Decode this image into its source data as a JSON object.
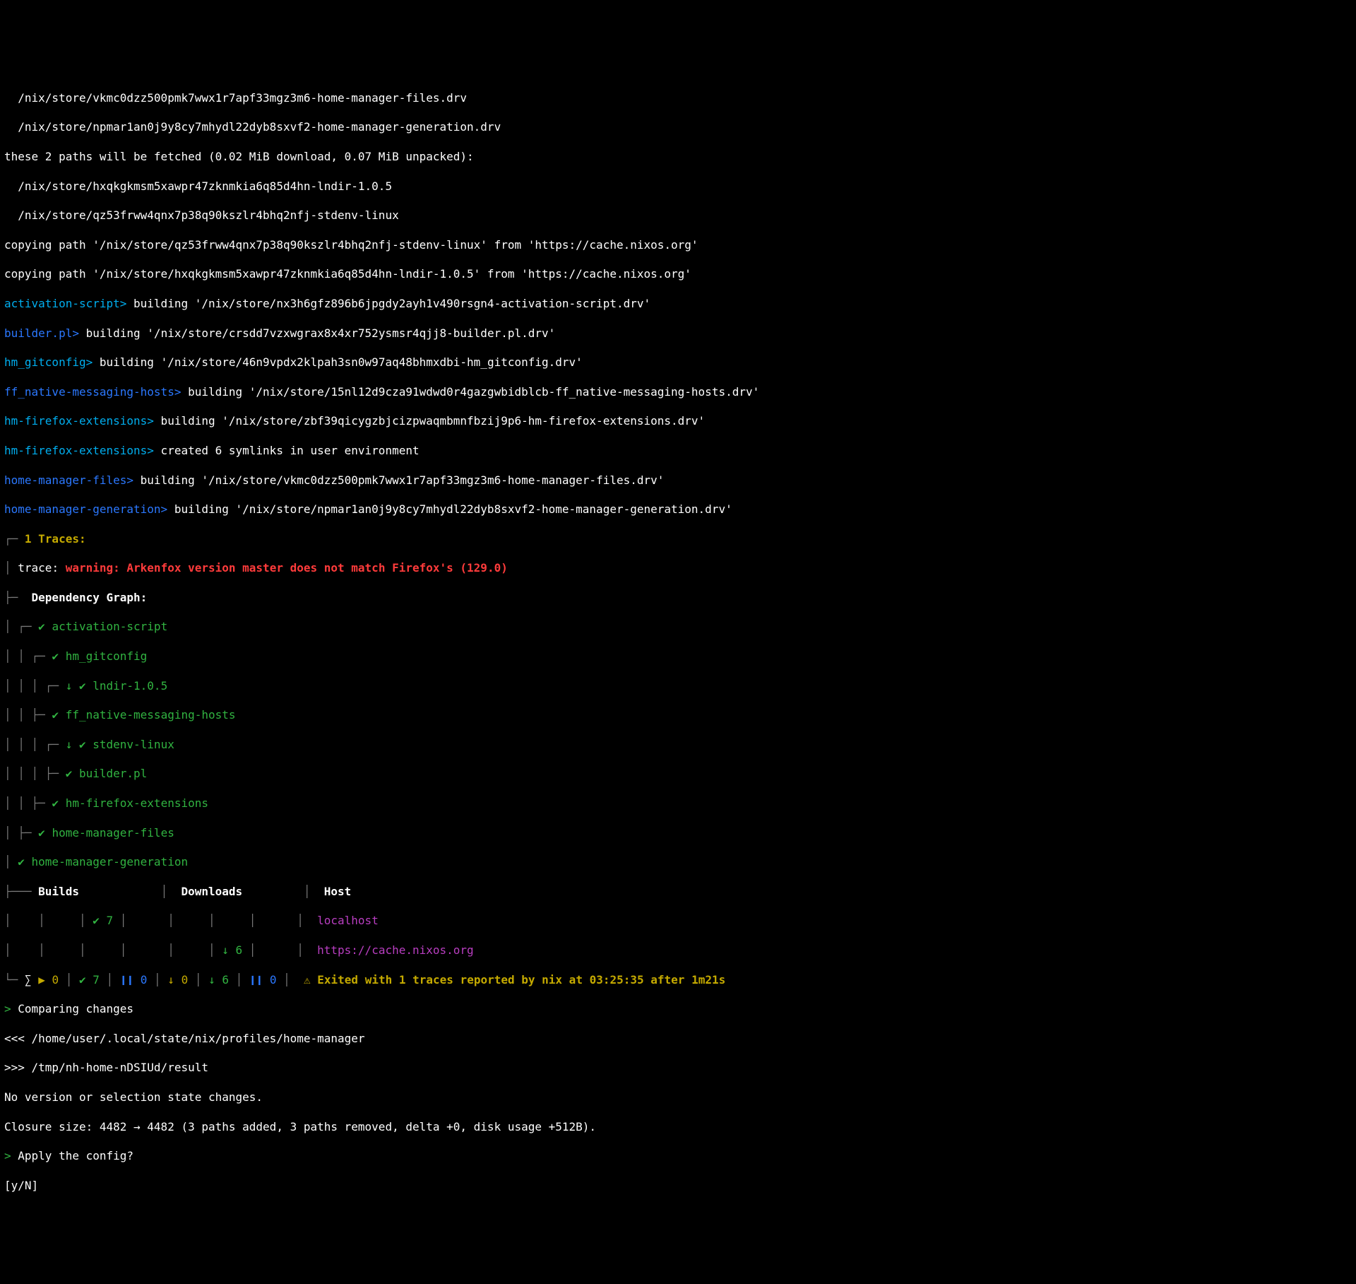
{
  "paths": {
    "hm_files_drv": "  /nix/store/vkmc0dzz500pmk7wwx1r7apf33mgz3m6-home-manager-files.drv",
    "hm_gen_drv": "  /nix/store/npmar1an0j9y8cy7mhydl22dyb8sxvf2-home-manager-generation.drv",
    "fetch_header": "these 2 paths will be fetched (0.02 MiB download, 0.07 MiB unpacked):",
    "lndir": "  /nix/store/hxqkgkmsm5xawpr47zknmkia6q85d4hn-lndir-1.0.5",
    "stdenv": "  /nix/store/qz53frww4qnx7p38q90kszlr4bhq2nfj-stdenv-linux",
    "copy1": "copying path '/nix/store/qz53frww4qnx7p38q90kszlr4bhq2nfj-stdenv-linux' from 'https://cache.nixos.org'",
    "copy2": "copying path '/nix/store/hxqkgkmsm5xawpr47zknmkia6q85d4hn-lndir-1.0.5' from 'https://cache.nixos.org'"
  },
  "builds": {
    "activation": {
      "tag": "activation-script>",
      "msg": " building '/nix/store/nx3h6gfz896b6jpgdy2ayh1v490rsgn4-activation-script.drv'"
    },
    "builder": {
      "tag": "builder.pl>",
      "msg": " building '/nix/store/crsdd7vzxwgrax8x4xr752ysmsr4qjj8-builder.pl.drv'"
    },
    "gitconfig": {
      "tag": "hm_gitconfig>",
      "msg": " building '/nix/store/46n9vpdx2klpah3sn0w97aq48bhmxdbi-hm_gitconfig.drv'"
    },
    "ffnative": {
      "tag": "ff_native-messaging-hosts>",
      "msg": " building '/nix/store/15nl12d9cza91wdwd0r4gazgwbidblcb-ff_native-messaging-hosts.drv'"
    },
    "ffx1": {
      "tag": "hm-firefox-extensions>",
      "msg": " building '/nix/store/zbf39qicygzbjcizpwaqmbmnfbzij9p6-hm-firefox-extensions.drv'"
    },
    "ffx2": {
      "tag": "hm-firefox-extensions>",
      "msg": " created 6 symlinks in user environment"
    },
    "hmfiles": {
      "tag": "home-manager-files>",
      "msg": " building '/nix/store/vkmc0dzz500pmk7wwx1r7apf33mgz3m6-home-manager-files.drv'"
    },
    "hmgen": {
      "tag": "home-manager-generation>",
      "msg": " building '/nix/store/npmar1an0j9y8cy7mhydl22dyb8sxvf2-home-manager-generation.drv'"
    }
  },
  "traces": {
    "header": " 1 Traces:",
    "trace_prefix": " trace: ",
    "trace_warning": "warning: Arkenfox version master does not match Firefox's (129.0)"
  },
  "depgraph": {
    "header": "  Dependency Graph:",
    "items": {
      "activation": "activation-script",
      "hm_gitconfig": "hm_gitconfig",
      "lndir": "lndir-1.0.5",
      "ffnative": "ff_native-messaging-hosts",
      "stdenv": "stdenv-linux",
      "builder": "builder.pl",
      "hm_ffx": "hm-firefox-extensions",
      "hm_files": "home-manager-files",
      "hm_gen": "home-manager-generation"
    }
  },
  "summary": {
    "builds_label": "Builds",
    "downloads_label": "Downloads",
    "host_label": "Host",
    "host1": "localhost",
    "host2": "https://cache.nixos.org",
    "exit": "⚠ Exited with 1 traces reported by nix at 03:25:35 after 1m21s"
  },
  "counts": {
    "sigma": "∑",
    "play": "▶",
    "b_running": "0",
    "b_ok": "7",
    "b_queued": "0",
    "d_running": "0",
    "d_down": "6",
    "d_queued": "0",
    "row2_b_ok": "7",
    "row2_d_down": "6",
    "pause": "❙❙"
  },
  "diff": {
    "comparing_prefix": "> ",
    "comparing": "Comparing changes",
    "lt": "<<< /home/user/.local/state/nix/profiles/home-manager",
    "gt": ">>> /tmp/nh-home-nDSIUd/result",
    "noversion": "No version or selection state changes.",
    "closure": "Closure size: 4482 → 4482 (3 paths added, 3 paths removed, delta +0, disk usage +512B).",
    "apply_prefix": "> ",
    "apply": "Apply the config?",
    "prompt": "[y/N] "
  }
}
